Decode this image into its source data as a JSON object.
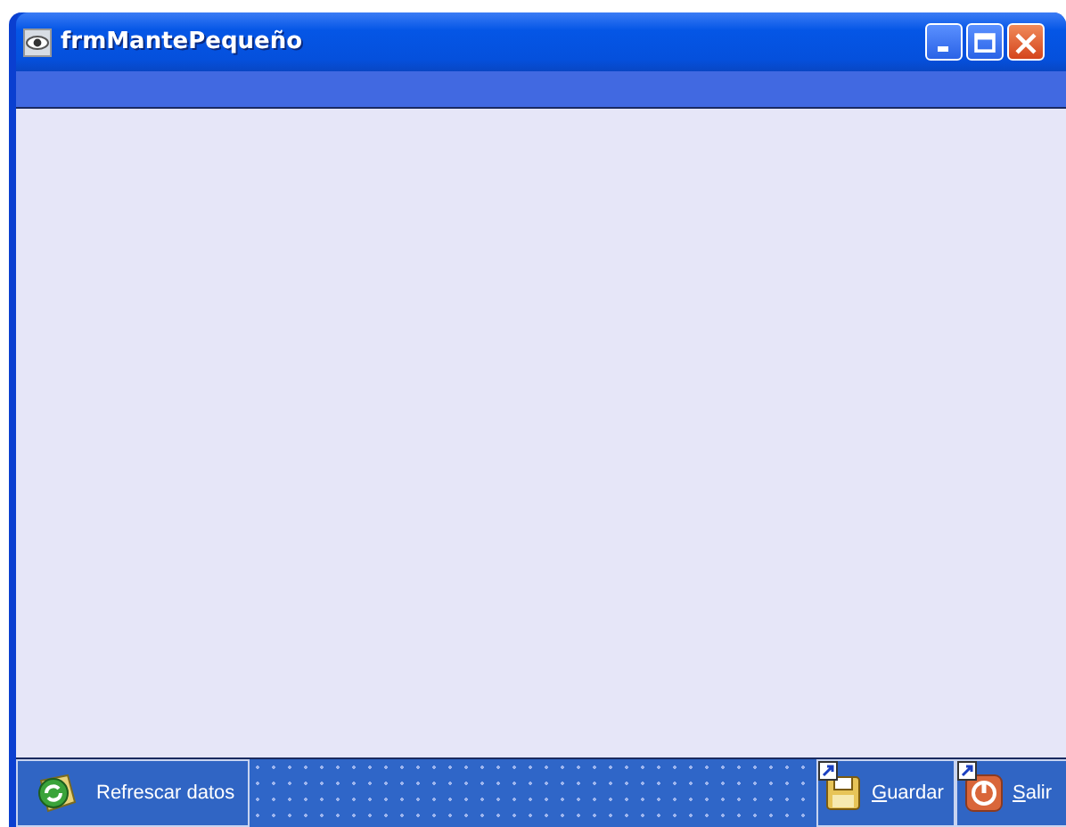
{
  "window": {
    "title": "frmMantePequeño"
  },
  "toolbar": {
    "left_button": {
      "label": "Refrescar datos"
    },
    "right_buttons": [
      {
        "access_key": "G",
        "label_rest": "uardar",
        "kind": "save"
      },
      {
        "access_key": "S",
        "label_rest": "alir",
        "kind": "exit"
      }
    ]
  }
}
